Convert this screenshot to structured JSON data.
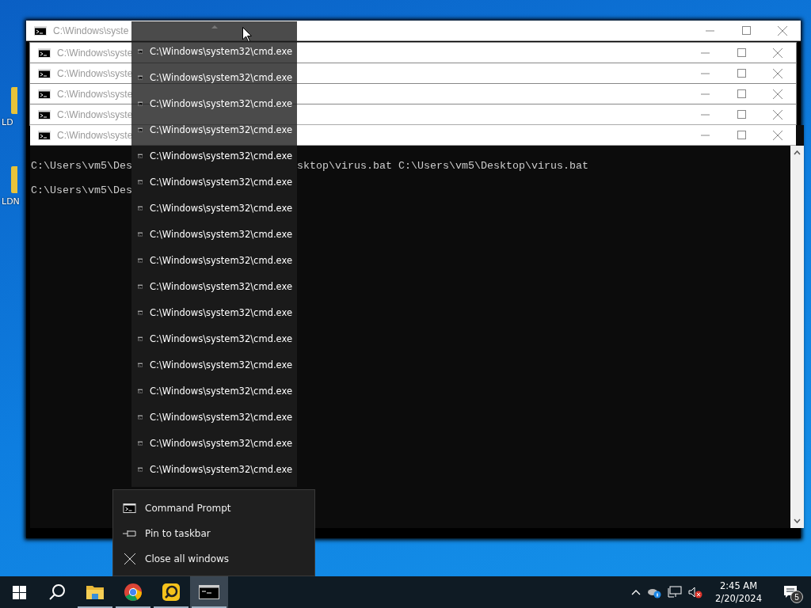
{
  "desktop_icons": [
    {
      "label": "LD"
    },
    {
      "label": "LDN"
    }
  ],
  "windows": [
    {
      "title": "C:\\Windows\\syste"
    },
    {
      "title": "C:\\Windows\\syste"
    },
    {
      "title": "C:\\Windows\\syste"
    },
    {
      "title": "C:\\Windows\\syste"
    },
    {
      "title": "C:\\Windows\\syste"
    },
    {
      "title": "C:\\Windows\\syste"
    }
  ],
  "console": {
    "lines": [
      {
        "segments": [
          "C:\\Users\\vm5\\Des",
          "sktop\\virus.bat C:\\Users\\vm5\\Desktop\\virus.bat"
        ]
      },
      {
        "segments": [
          "C:\\Users\\vm5\\Des"
        ]
      }
    ]
  },
  "thumbnail_list": {
    "items": [
      "C:\\Windows\\system32\\cmd.exe",
      "C:\\Windows\\system32\\cmd.exe",
      "C:\\Windows\\system32\\cmd.exe",
      "C:\\Windows\\system32\\cmd.exe",
      "C:\\Windows\\system32\\cmd.exe",
      "C:\\Windows\\system32\\cmd.exe",
      "C:\\Windows\\system32\\cmd.exe",
      "C:\\Windows\\system32\\cmd.exe",
      "C:\\Windows\\system32\\cmd.exe",
      "C:\\Windows\\system32\\cmd.exe",
      "C:\\Windows\\system32\\cmd.exe",
      "C:\\Windows\\system32\\cmd.exe",
      "C:\\Windows\\system32\\cmd.exe",
      "C:\\Windows\\system32\\cmd.exe",
      "C:\\Windows\\system32\\cmd.exe",
      "C:\\Windows\\system32\\cmd.exe",
      "C:\\Windows\\system32\\cmd.exe"
    ]
  },
  "jump_list": {
    "items": [
      {
        "kind": "app",
        "label": "Command Prompt"
      },
      {
        "kind": "pin",
        "label": "Pin to taskbar"
      },
      {
        "kind": "close",
        "label": "Close all windows"
      }
    ]
  },
  "taskbar": {
    "apps": [
      {
        "kind": "explorer",
        "selected": false
      },
      {
        "kind": "chrome",
        "selected": false
      },
      {
        "kind": "recorder",
        "selected": false
      },
      {
        "kind": "cmd",
        "selected": true
      }
    ],
    "clock": {
      "time": "2:45 AM",
      "date": "2/20/2024"
    },
    "notifications": {
      "count": "5"
    }
  }
}
